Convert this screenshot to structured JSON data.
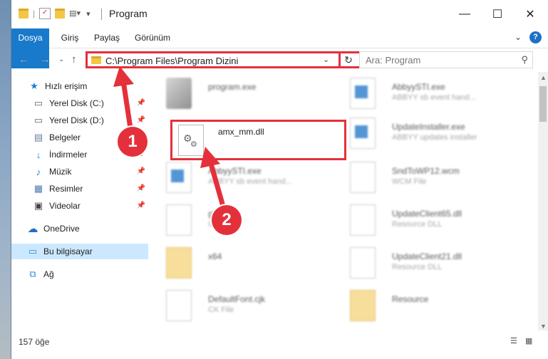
{
  "window": {
    "title": "Program",
    "minimize": "—",
    "maximize": "☐",
    "close": "✕"
  },
  "ribbon": {
    "tabs": [
      "Dosya",
      "Giriş",
      "Paylaş",
      "Görünüm"
    ],
    "help": "?"
  },
  "address_bar": {
    "path": "C:\\Program Files\\Program Dizini",
    "search_placeholder": "Ara: Program"
  },
  "nav_pane": {
    "items": [
      {
        "label": "Hızlı erişim",
        "icon": "star-icon"
      },
      {
        "label": "Yerel Disk (C:)",
        "icon": "drive-icon",
        "pinned": true
      },
      {
        "label": "Yerel Disk (D:)",
        "icon": "drive-icon",
        "pinned": true
      },
      {
        "label": "Belgeler",
        "icon": "documents-icon",
        "pinned": true
      },
      {
        "label": "İndirmeler",
        "icon": "download-icon",
        "pinned": true
      },
      {
        "label": "Müzik",
        "icon": "music-icon",
        "pinned": true
      },
      {
        "label": "Resimler",
        "icon": "pictures-icon",
        "pinned": true
      },
      {
        "label": "Videolar",
        "icon": "videos-icon",
        "pinned": true
      },
      {
        "label": "OneDrive",
        "icon": "onedrive-icon"
      },
      {
        "label": "Bu bilgisayar",
        "icon": "computer-icon",
        "selected": true
      },
      {
        "label": "Ağ",
        "icon": "network-icon"
      }
    ]
  },
  "files": [
    {
      "name": "program.exe",
      "desc": "",
      "col": 0
    },
    {
      "name": "AbbyySTI.exe",
      "desc": "ABBYY sb event hand...",
      "col": 1
    },
    {
      "name": "amx_mm.dll",
      "desc": "",
      "col": 0
    },
    {
      "name": "UpdateInstaller.exe",
      "desc": "ABBYY updates installer",
      "col": 1
    },
    {
      "name": "AbbyySTI.exe",
      "desc": "ABBYY sb event hand...",
      "col": 0
    },
    {
      "name": "SndToWP12.wcm",
      "desc": "WCM File",
      "col": 1
    },
    {
      "name": "gbc...",
      "desc": "CK File",
      "col": 0
    },
    {
      "name": "UpdateClient65.dll",
      "desc": "Resource DLL",
      "col": 1
    },
    {
      "name": "x64",
      "desc": "",
      "col": 0
    },
    {
      "name": "UpdateClient21.dll",
      "desc": "Resource DLL",
      "col": 1
    },
    {
      "name": "DefaultFont.cjk",
      "desc": "CK File",
      "col": 0
    },
    {
      "name": "Resource",
      "desc": "",
      "col": 1
    }
  ],
  "status_bar": {
    "count": "157 öğe"
  },
  "callouts": [
    "1",
    "2"
  ],
  "colors": {
    "accent": "#1979ca",
    "highlight": "#e4303a",
    "selection": "#cce8ff"
  }
}
